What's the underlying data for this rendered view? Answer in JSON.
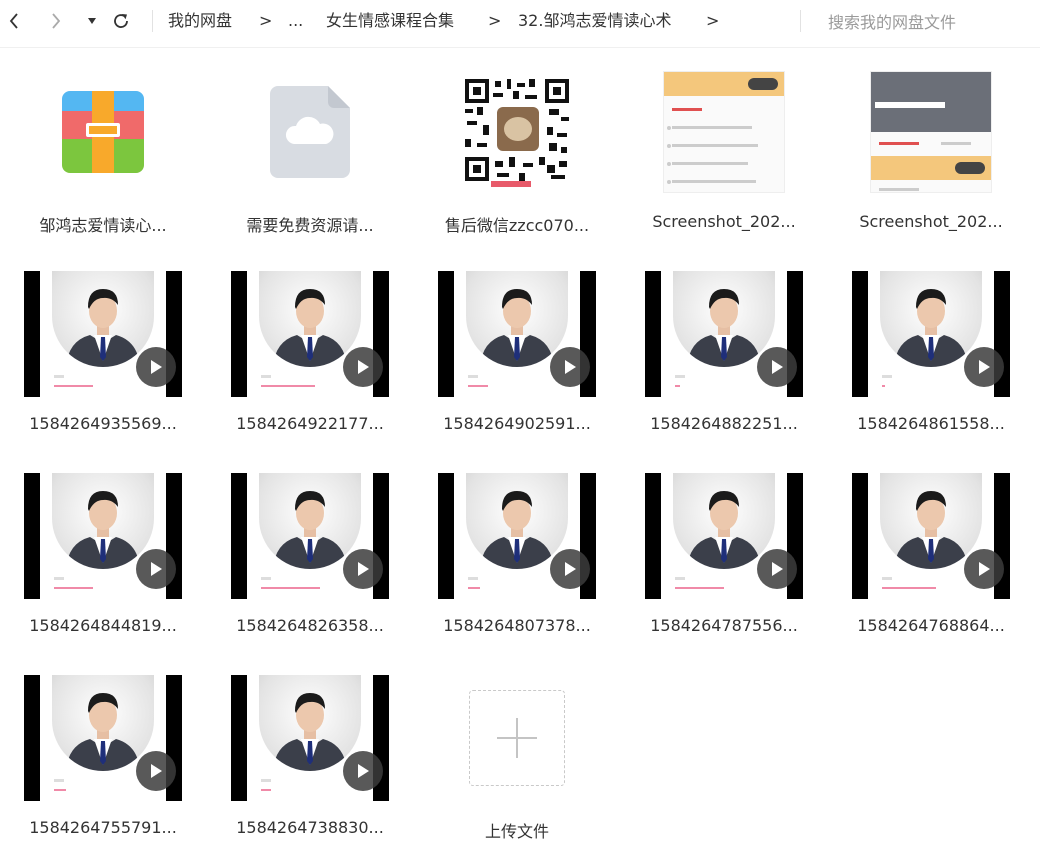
{
  "nav": {
    "back_label": "back",
    "forward_label": "forward",
    "breadcrumb": [
      "我的网盘",
      "...",
      "女生情感课程合集",
      "32.邹鸿志爱情读心术"
    ],
    "separators": [
      ">",
      ">",
      ">",
      ">"
    ],
    "search_placeholder": "搜索我的网盘文件"
  },
  "files": [
    {
      "name": "邹鸿志爱情读心...",
      "kind": "archive"
    },
    {
      "name": "需要免费资源请...",
      "kind": "cloud-file"
    },
    {
      "name": "售后微信zzcc070...",
      "kind": "qr-image"
    },
    {
      "name": "Screenshot_202...",
      "kind": "screenshot"
    },
    {
      "name": "Screenshot_202...",
      "kind": "screenshot"
    },
    {
      "name": "1584264935569...",
      "kind": "video"
    },
    {
      "name": "1584264922177...",
      "kind": "video"
    },
    {
      "name": "1584264902591...",
      "kind": "video"
    },
    {
      "name": "1584264882251...",
      "kind": "video"
    },
    {
      "name": "1584264861558...",
      "kind": "video"
    },
    {
      "name": "1584264844819...",
      "kind": "video"
    },
    {
      "name": "1584264826358...",
      "kind": "video"
    },
    {
      "name": "1584264807378...",
      "kind": "video"
    },
    {
      "name": "1584264787556...",
      "kind": "video"
    },
    {
      "name": "1584264768864...",
      "kind": "video"
    },
    {
      "name": "1584264755791...",
      "kind": "video"
    },
    {
      "name": "1584264738830...",
      "kind": "video"
    }
  ],
  "upload": {
    "label": "上传文件"
  },
  "video_progress": [
    0.4,
    0.55,
    0.2,
    0.05,
    0.03,
    0.4,
    0.6,
    0.12,
    0.5,
    0.55,
    0.12,
    0.1
  ],
  "colors": {
    "accent_pink": "#f08aa8",
    "text": "#333333",
    "placeholder": "#9a9a9a"
  }
}
